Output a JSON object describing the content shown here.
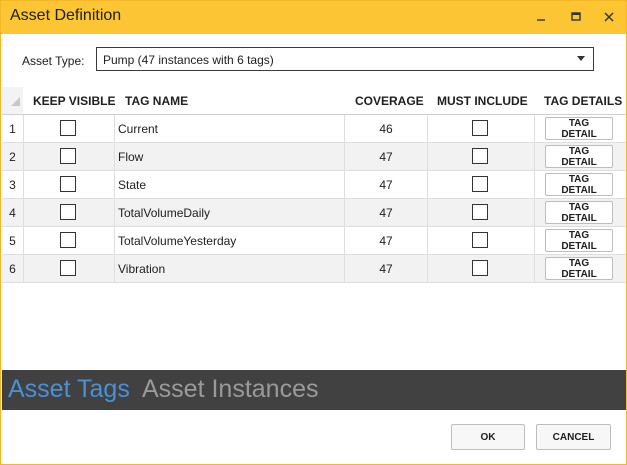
{
  "window": {
    "title": "Asset Definition"
  },
  "asset_type": {
    "label": "Asset Type:",
    "selected": "Pump (47 instances with 6 tags)"
  },
  "grid": {
    "headers": {
      "keep_visible": "KEEP VISIBLE",
      "tag_name": "TAG NAME",
      "coverage": "COVERAGE",
      "must_include": "MUST INCLUDE",
      "tag_details": "TAG DETAILS"
    },
    "rows": [
      {
        "num": "1",
        "tag": "Current",
        "coverage": "46",
        "keep_visible": false,
        "must_include": false,
        "button": "TAG DETAIL"
      },
      {
        "num": "2",
        "tag": "Flow",
        "coverage": "47",
        "keep_visible": false,
        "must_include": false,
        "button": "TAG DETAIL"
      },
      {
        "num": "3",
        "tag": "State",
        "coverage": "47",
        "keep_visible": false,
        "must_include": false,
        "button": "TAG DETAIL"
      },
      {
        "num": "4",
        "tag": "TotalVolumeDaily",
        "coverage": "47",
        "keep_visible": false,
        "must_include": false,
        "button": "TAG DETAIL"
      },
      {
        "num": "5",
        "tag": "TotalVolumeYesterday",
        "coverage": "47",
        "keep_visible": false,
        "must_include": false,
        "button": "TAG DETAIL"
      },
      {
        "num": "6",
        "tag": "Vibration",
        "coverage": "47",
        "keep_visible": false,
        "must_include": false,
        "button": "TAG DETAIL"
      }
    ]
  },
  "tabs": {
    "active": "Asset Tags",
    "inactive": "Asset Instances"
  },
  "footer": {
    "ok": "OK",
    "cancel": "CANCEL"
  },
  "colors": {
    "titlebar": "#fbc533",
    "tabbar": "#414141",
    "active_tab": "#4a90d9",
    "inactive_tab": "#9a9a9a"
  }
}
